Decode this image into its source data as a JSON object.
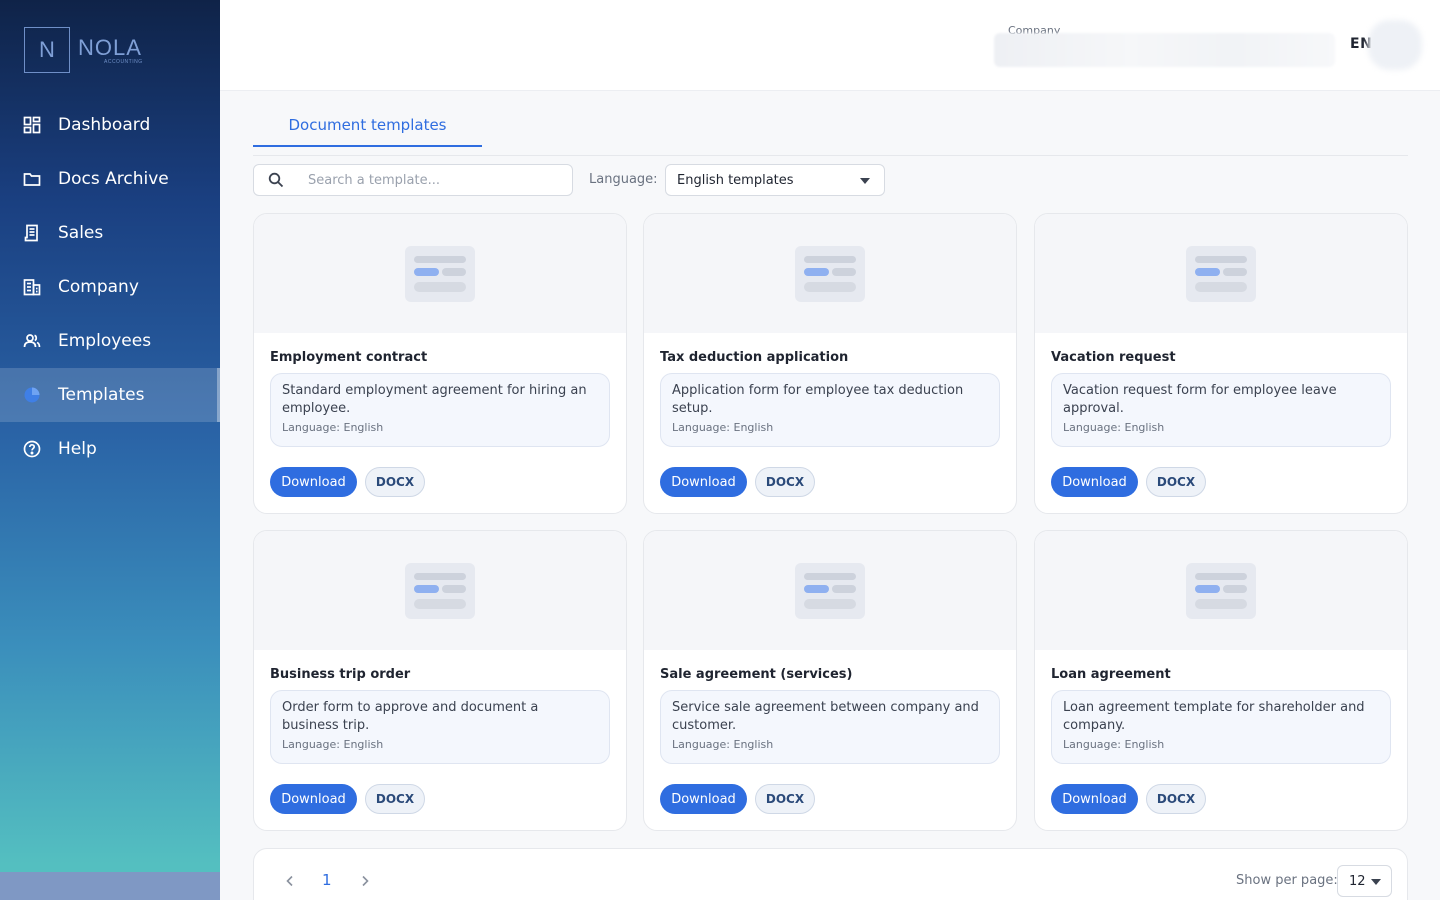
{
  "brand": {
    "initial": "N",
    "name": "NOLA",
    "sub": "ACCOUNTING"
  },
  "nav": [
    {
      "label": "Dashboard",
      "icon": "dashboard-icon"
    },
    {
      "label": "Docs Archive",
      "icon": "folder-icon"
    },
    {
      "label": "Sales",
      "icon": "receipt-icon"
    },
    {
      "label": "Company",
      "icon": "building-icon"
    },
    {
      "label": "Employees",
      "icon": "users-icon"
    },
    {
      "label": "Templates",
      "icon": "template-icon",
      "active": true
    },
    {
      "label": "Help",
      "icon": "help-icon"
    }
  ],
  "header": {
    "company_label": "Company",
    "language_button": "EN"
  },
  "tabs": [
    {
      "label": "Document templates",
      "active": true
    }
  ],
  "toolbar": {
    "search_placeholder": "Search a template...",
    "language_label": "Language:",
    "language_value": "English templates"
  },
  "templates": [
    {
      "title": "Employment contract",
      "description": "Standard employment agreement for hiring an employee.",
      "language": "Language: English",
      "download": "Download",
      "format": "DOCX"
    },
    {
      "title": "Tax deduction application",
      "description": "Application form for employee tax deduction setup.",
      "language": "Language: English",
      "download": "Download",
      "format": "DOCX"
    },
    {
      "title": "Vacation request",
      "description": "Vacation request form for employee leave approval.",
      "language": "Language: English",
      "download": "Download",
      "format": "DOCX"
    },
    {
      "title": "Business trip order",
      "description": "Order form to approve and document a business trip.",
      "language": "Language: English",
      "download": "Download",
      "format": "DOCX"
    },
    {
      "title": "Sale agreement (services)",
      "description": "Service sale agreement between company and customer.",
      "language": "Language: English",
      "download": "Download",
      "format": "DOCX"
    },
    {
      "title": "Loan agreement",
      "description": "Loan agreement template for shareholder and company.",
      "language": "Language: English",
      "download": "Download",
      "format": "DOCX"
    }
  ],
  "pagination": {
    "current_page": "1",
    "per_page_label": "Show per page:",
    "per_page_value": "12"
  },
  "colors": {
    "accent": "#2f6de0",
    "sidebar_top": "#0f2348",
    "sidebar_bottom": "#54bfc0"
  }
}
